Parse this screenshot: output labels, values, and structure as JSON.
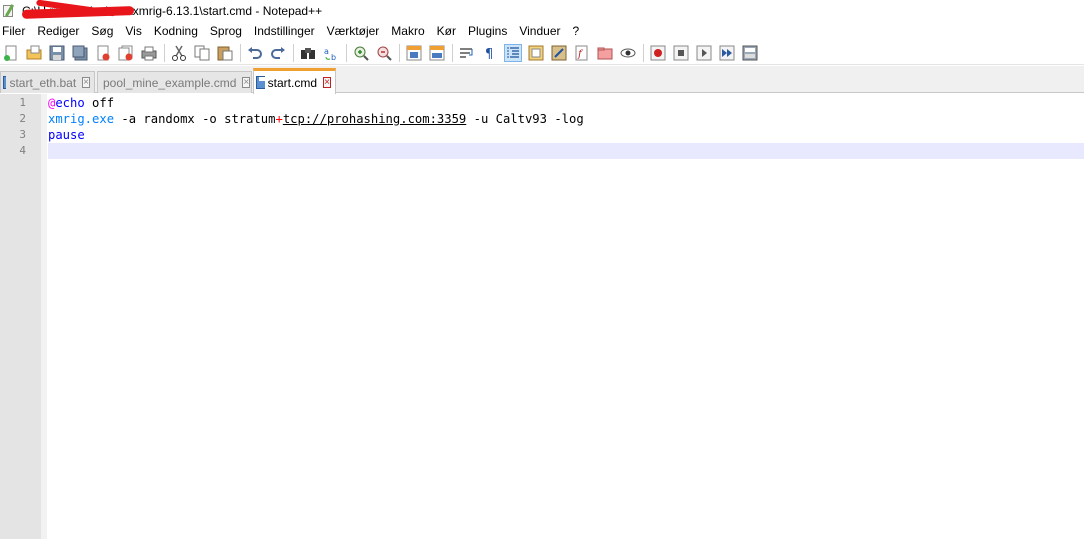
{
  "window": {
    "title_visible": "C:\\U                   rive\\Skrivebord\\xmrig-6.13.1\\start.cmd - Notepad++"
  },
  "menu": [
    "Filer",
    "Rediger",
    "Søg",
    "Vis",
    "Kodning",
    "Sprog",
    "Indstillinger",
    "Værktøjer",
    "Makro",
    "Kør",
    "Plugins",
    "Vinduer",
    "?"
  ],
  "tabs": [
    {
      "label": "start_eth.bat",
      "active": false
    },
    {
      "label": "pool_mine_example.cmd",
      "active": false
    },
    {
      "label": "start.cmd",
      "active": true
    }
  ],
  "editor": {
    "line_numbers": [
      "1",
      "2",
      "3",
      "4"
    ],
    "lines": {
      "l1_at": "@",
      "l1_kw": "echo",
      "l1_rest": " off",
      "l2_cmd": "xmrig.exe",
      "l2_a": " -a randomx -o stratum",
      "l2_plus": "+",
      "l2_url": "tcp://prohashing.com:3359",
      "l2_rest": " -u Caltv93 -log",
      "l3_kw": "pause",
      "l4": ""
    },
    "current_line": 4
  },
  "colors": {
    "tab_active_accent": "#f0a030",
    "current_line_bg": "#e8e8ff",
    "keyword": "#0000ff",
    "at_symbol": "#ff00ff",
    "operator": "#ff0000",
    "command": "#0080ff"
  },
  "toolbar_icons": [
    "new-file-icon",
    "open-file-icon",
    "save-icon",
    "save-all-icon",
    "close-icon",
    "close-all-icon",
    "print-icon",
    "cut-icon",
    "copy-icon",
    "paste-icon",
    "undo-icon",
    "redo-icon",
    "find-icon",
    "replace-icon",
    "zoom-in-icon",
    "zoom-out-icon",
    "sync-vertical-icon",
    "sync-horizontal-icon",
    "word-wrap-icon",
    "show-all-chars-icon",
    "indent-guide-icon",
    "user-language-icon",
    "doc-map-icon",
    "function-list-icon",
    "folder-workspace-icon",
    "monitoring-icon",
    "record-macro-icon",
    "stop-record-icon",
    "play-macro-icon",
    "run-macro-multiple-icon",
    "save-macro-icon"
  ]
}
